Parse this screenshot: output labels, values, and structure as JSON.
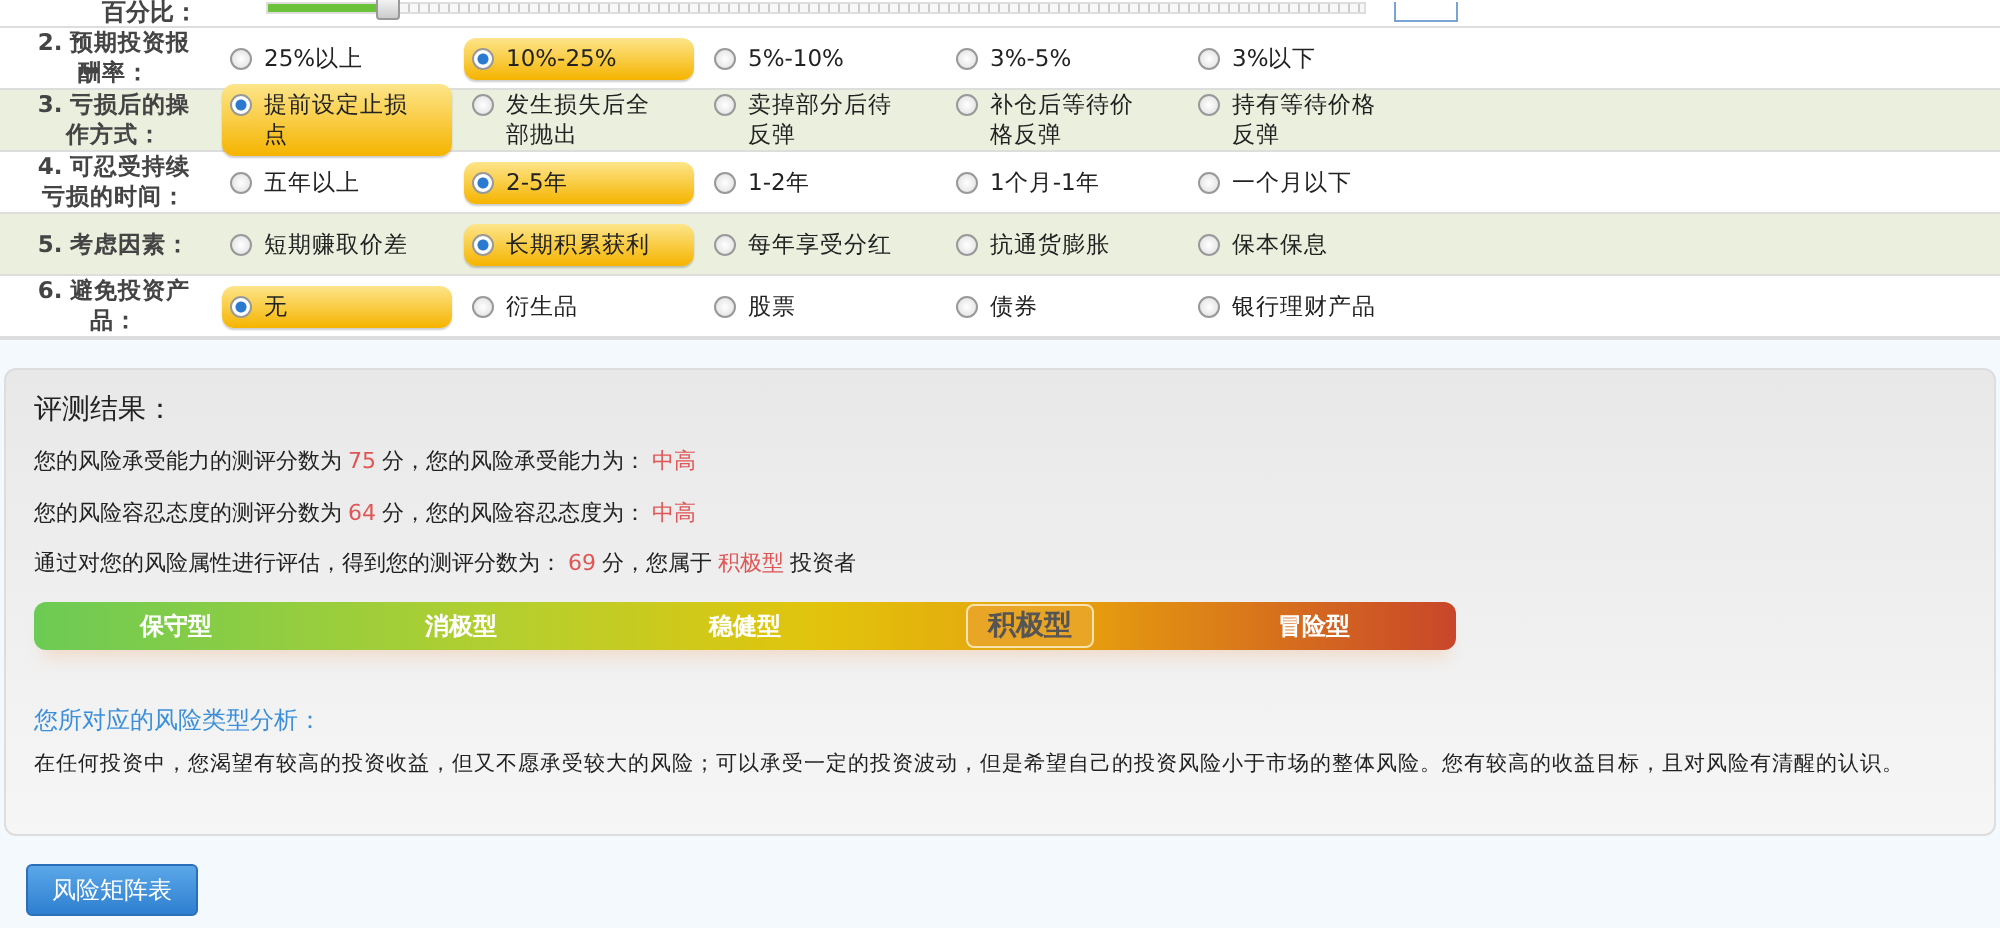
{
  "top_row": {
    "label": "百分比：",
    "slider": {
      "level": 0.11
    }
  },
  "questions": [
    {
      "label": "2. 预期投资报酬率：",
      "options": [
        {
          "text": "25%以上",
          "selected": false
        },
        {
          "text": "10%-25%",
          "selected": true
        },
        {
          "text": "5%-10%",
          "selected": false
        },
        {
          "text": "3%-5%",
          "selected": false
        },
        {
          "text": "3%以下",
          "selected": false
        }
      ]
    },
    {
      "label": "3. 亏损后的操作方式：",
      "options": [
        {
          "text": "提前设定止损点",
          "selected": true
        },
        {
          "text": "发生损失后全部抛出",
          "selected": false
        },
        {
          "text": "卖掉部分后待反弹",
          "selected": false
        },
        {
          "text": "补仓后等待价格反弹",
          "selected": false
        },
        {
          "text": "持有等待价格反弹",
          "selected": false
        }
      ]
    },
    {
      "label": "4. 可忍受持续亏损的时间：",
      "options": [
        {
          "text": "五年以上",
          "selected": false
        },
        {
          "text": "2-5年",
          "selected": true
        },
        {
          "text": "1-2年",
          "selected": false
        },
        {
          "text": "1个月-1年",
          "selected": false
        },
        {
          "text": "一个月以下",
          "selected": false
        }
      ]
    },
    {
      "label": "5. 考虑因素：",
      "options": [
        {
          "text": "短期赚取价差",
          "selected": false
        },
        {
          "text": "长期积累获利",
          "selected": true
        },
        {
          "text": "每年享受分红",
          "selected": false
        },
        {
          "text": "抗通货膨胀",
          "selected": false
        },
        {
          "text": "保本保息",
          "selected": false
        }
      ]
    },
    {
      "label": "6. 避免投资产品：",
      "options": [
        {
          "text": "无",
          "selected": true
        },
        {
          "text": "衍生品",
          "selected": false
        },
        {
          "text": "股票",
          "selected": false
        },
        {
          "text": "债券",
          "selected": false
        },
        {
          "text": "银行理财产品",
          "selected": false
        }
      ]
    }
  ],
  "result": {
    "title": "评测结果：",
    "lines": [
      [
        {
          "text": "您的风险承受能力的测评分数为",
          "highlight": false
        },
        {
          "text": "75",
          "highlight": true
        },
        {
          "text": "分，您的风险承受能力为：",
          "highlight": false
        },
        {
          "text": "中高",
          "highlight": true
        }
      ],
      [
        {
          "text": "您的风险容忍态度的测评分数为",
          "highlight": false
        },
        {
          "text": "64",
          "highlight": true
        },
        {
          "text": "分，您的风险容忍态度为：",
          "highlight": false
        },
        {
          "text": "中高",
          "highlight": true
        }
      ],
      [
        {
          "text": "通过对您的风险属性进行评估，得到您的测评分数为：",
          "highlight": false
        },
        {
          "text": "69",
          "highlight": true
        },
        {
          "text": "分，您属于",
          "highlight": false
        },
        {
          "text": "积极型",
          "highlight": true
        },
        {
          "text": "投资者",
          "highlight": false
        }
      ]
    ],
    "scale": [
      {
        "label": "保守型",
        "selected": false
      },
      {
        "label": "消极型",
        "selected": false
      },
      {
        "label": "稳健型",
        "selected": false
      },
      {
        "label": "积极型",
        "selected": true
      },
      {
        "label": "冒险型",
        "selected": false
      }
    ],
    "analysis_title": "您所对应的风险类型分析：",
    "analysis": "在任何投资中，您渴望有较高的投资收益，但又不愿承受较大的风险；可以承受一定的投资波动，但是希望自己的投资风险小于市场的整体风险。您有较高的收益目标，且对风险有清醒的认识。"
  },
  "button": "风险矩阵表"
}
